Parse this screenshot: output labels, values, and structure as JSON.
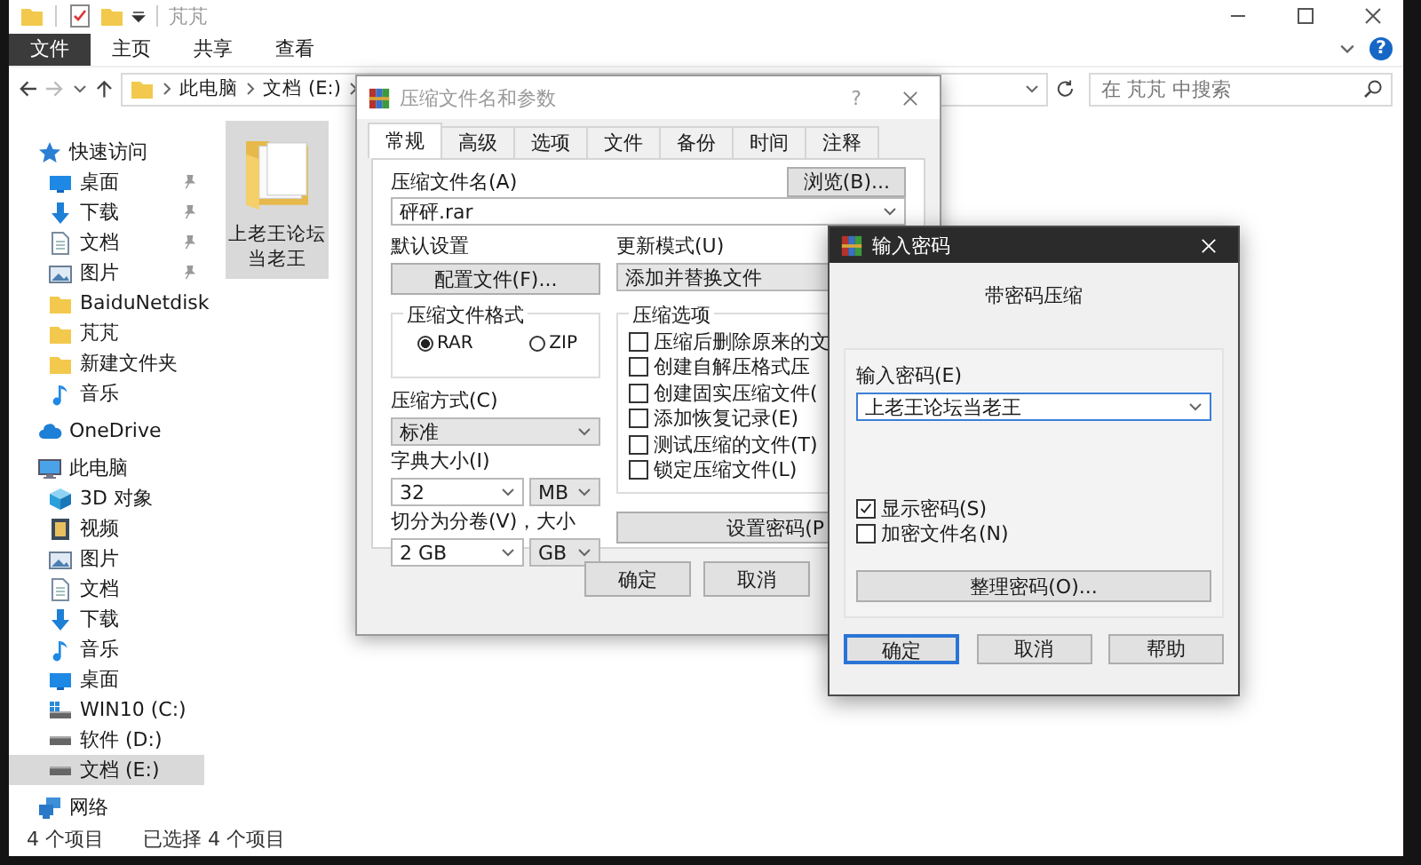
{
  "explorer": {
    "title": "芃芃",
    "help": "?",
    "ribbon_tabs": [
      {
        "label": "文件",
        "selected": true
      },
      {
        "label": "主页",
        "selected": false
      },
      {
        "label": "共享",
        "selected": false
      },
      {
        "label": "查看",
        "selected": false
      }
    ],
    "breadcrumb": [
      "此电脑",
      "文档 (E:)"
    ],
    "search": {
      "placeholder": "在 芃芃 中搜索"
    },
    "sidebar": [
      {
        "label": "快速访问",
        "kind": "star",
        "selected": false,
        "children": [
          {
            "label": "桌面",
            "kind": "desktop",
            "pinned": true,
            "selected": false
          },
          {
            "label": "下载",
            "kind": "download",
            "pinned": true,
            "selected": false
          },
          {
            "label": "文档",
            "kind": "document",
            "pinned": true,
            "selected": false
          },
          {
            "label": "图片",
            "kind": "picture",
            "pinned": true,
            "selected": false
          },
          {
            "label": "BaiduNetdisk",
            "kind": "folder",
            "pinned": false,
            "selected": false
          },
          {
            "label": "芃芃",
            "kind": "folder",
            "pinned": false,
            "selected": false
          },
          {
            "label": "新建文件夹",
            "kind": "folder",
            "pinned": false,
            "selected": false
          },
          {
            "label": "音乐",
            "kind": "music",
            "pinned": false,
            "selected": false
          }
        ]
      },
      {
        "label": "OneDrive",
        "kind": "cloud",
        "selected": false
      },
      {
        "label": "此电脑",
        "kind": "computer",
        "selected": false,
        "children": [
          {
            "label": "3D 对象",
            "kind": "cube",
            "selected": false
          },
          {
            "label": "视频",
            "kind": "film",
            "selected": false
          },
          {
            "label": "图片",
            "kind": "picture",
            "selected": false
          },
          {
            "label": "文档",
            "kind": "document",
            "selected": false
          },
          {
            "label": "下载",
            "kind": "download",
            "selected": false
          },
          {
            "label": "音乐",
            "kind": "music",
            "selected": false
          },
          {
            "label": "桌面",
            "kind": "desktop",
            "selected": false
          },
          {
            "label": "WIN10 (C:)",
            "kind": "system_drive",
            "selected": false
          },
          {
            "label": "软件 (D:)",
            "kind": "drive",
            "selected": false
          },
          {
            "label": "文档 (E:)",
            "kind": "drive",
            "selected": true
          }
        ]
      },
      {
        "label": "网络",
        "kind": "network",
        "selected": false
      }
    ],
    "files": [
      {
        "name": "上老王论坛当老王",
        "selected": true
      }
    ],
    "status_bar": {
      "item_count": "4 个项目",
      "selection": "已选择 4 个项目"
    }
  },
  "archive_dialog": {
    "title": "压缩文件名和参数",
    "help": "?",
    "tabs": [
      {
        "label": "常规",
        "selected": true
      },
      {
        "label": "高级",
        "selected": false
      },
      {
        "label": "选项",
        "selected": false
      },
      {
        "label": "文件",
        "selected": false
      },
      {
        "label": "备份",
        "selected": false
      },
      {
        "label": "时间",
        "selected": false
      },
      {
        "label": "注释",
        "selected": false
      }
    ],
    "archive_name": {
      "label": "压缩文件名(A)",
      "value": "砰砰.rar"
    },
    "browse_button": "浏览(B)...",
    "profiles": {
      "label": "默认设置",
      "button": "配置文件(F)..."
    },
    "update_mode": {
      "label": "更新模式(U)",
      "value": "添加并替换文件"
    },
    "format": {
      "label": "压缩文件格式",
      "options": [
        {
          "label": "RAR",
          "selected": true
        },
        {
          "label": "ZIP",
          "selected": false
        }
      ]
    },
    "method": {
      "label": "压缩方式(C)",
      "value": "标准"
    },
    "dictionary": {
      "label": "字典大小(I)",
      "value": "32",
      "unit": "MB"
    },
    "split": {
      "label": "切分为分卷(V)，大小",
      "value": "2 GB",
      "unit": "GB"
    },
    "options": {
      "label": "压缩选项",
      "items": [
        {
          "label": "压缩后删除原来的文",
          "checked": false
        },
        {
          "label": "创建自解压格式压",
          "checked": false
        },
        {
          "label": "创建固实压缩文件(",
          "checked": false
        },
        {
          "label": "添加恢复记录(E)",
          "checked": false
        },
        {
          "label": "测试压缩的文件(T)",
          "checked": false
        },
        {
          "label": "锁定压缩文件(L)",
          "checked": false
        }
      ]
    },
    "set_password_button": "设置密码(P",
    "buttons": [
      "确定",
      "取消"
    ]
  },
  "password_dialog": {
    "title": "输入密码",
    "heading": "带密码压缩",
    "password": {
      "label": "输入密码(E)",
      "value": "上老王论坛当老王"
    },
    "options": [
      {
        "label": "显示密码(S)",
        "checked": true
      },
      {
        "label": "加密文件名(N)",
        "checked": false
      }
    ],
    "organize_button": "整理密码(O)...",
    "buttons": [
      {
        "label": "确定",
        "default": true
      },
      {
        "label": "取消",
        "default": false
      },
      {
        "label": "帮助",
        "default": false
      }
    ]
  }
}
